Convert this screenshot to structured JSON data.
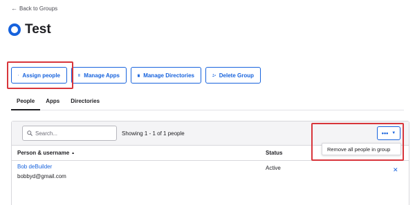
{
  "back_link": {
    "icon": "arrow-left-icon",
    "label": "Back to Groups"
  },
  "group": {
    "icon": "okta-group-icon",
    "title": "Test"
  },
  "actions": {
    "assign_people": "Assign people",
    "manage_apps": "Manage Apps",
    "manage_directories": "Manage Directories",
    "delete_group": "Delete Group"
  },
  "tabs": [
    {
      "label": "People",
      "active": true
    },
    {
      "label": "Apps",
      "active": false
    },
    {
      "label": "Directories",
      "active": false
    }
  ],
  "toolbar": {
    "search_placeholder": "Search...",
    "showing": "Showing 1 - 1 of 1 people",
    "more_label": "•••",
    "more_caret": "▼"
  },
  "dropdown_menu": {
    "items": [
      {
        "label": "Remove all people in group"
      }
    ]
  },
  "table": {
    "headers": {
      "person": "Person & username",
      "sort_glyph": "▲",
      "status": "Status"
    },
    "rows": [
      {
        "name": "Bob deBuilder",
        "email": "bobbyd@gmail.com",
        "status": "Active",
        "remove_glyph": "✕"
      }
    ]
  },
  "colors": {
    "accent": "#1662dd",
    "highlight": "#d8343a",
    "text": "#1d1d21",
    "toolbar_bg": "#f4f4f6"
  }
}
